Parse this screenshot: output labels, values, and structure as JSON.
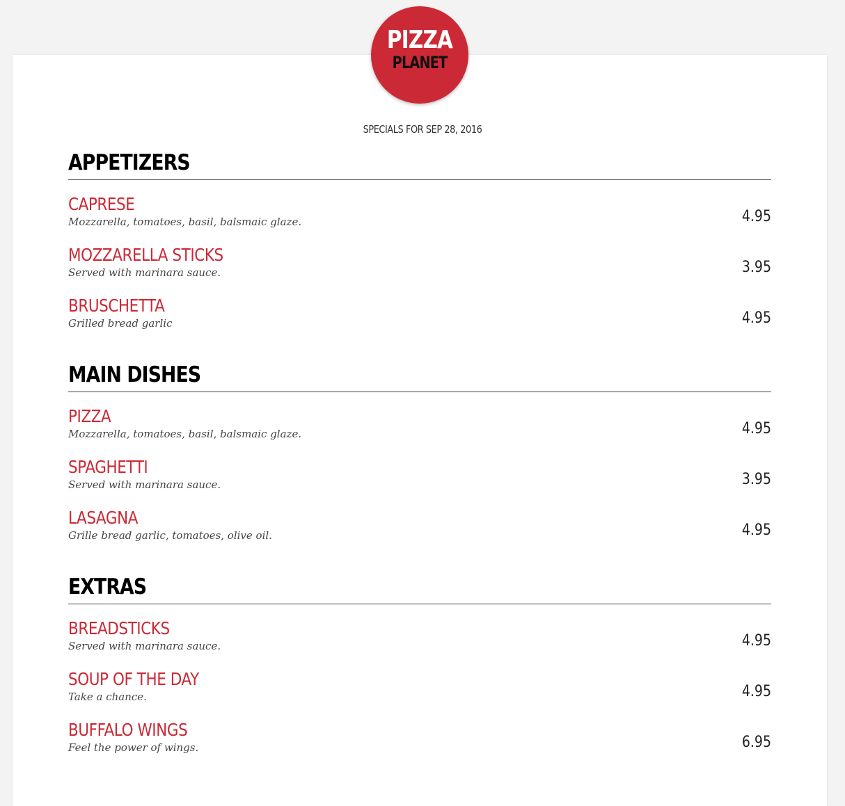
{
  "logo": {
    "top_text": "PIZZA",
    "bottom_text": "PLANET",
    "background_color": "#cc2936"
  },
  "specials_text": "SPECIALS FOR SEP 28, 2016",
  "sections": [
    {
      "title": "APPETIZERS",
      "items": [
        {
          "name": "CAPRESE",
          "description": "Mozzarella, tomatoes, basil, balsmaic glaze.",
          "price": "4.95"
        },
        {
          "name": "MOZZARELLA STICKS",
          "description": "Served with marinara sauce.",
          "price": "3.95"
        },
        {
          "name": "BRUSCHETTA",
          "description": "Grilled bread garlic",
          "price": "4.95"
        }
      ]
    },
    {
      "title": "MAIN DISHES",
      "items": [
        {
          "name": "PIZZA",
          "description": "Mozzarella, tomatoes, basil, balsmaic glaze.",
          "price": "4.95"
        },
        {
          "name": "SPAGHETTI",
          "description": "Served with marinara sauce.",
          "price": "3.95"
        },
        {
          "name": "LASAGNA",
          "description": "Grille bread garlic, tomatoes, olive oil.",
          "price": "4.95"
        }
      ]
    },
    {
      "title": "EXTRAS",
      "items": [
        {
          "name": "BREADSTICKS",
          "description": "Served with marinara sauce.",
          "price": "4.95"
        },
        {
          "name": "SOUP OF THE DAY",
          "description": "Take a chance.",
          "price": "4.95"
        },
        {
          "name": "BUFFALO WINGS",
          "description": "Feel the power of wings.",
          "price": "6.95"
        }
      ]
    }
  ],
  "colors": {
    "accent": "#cc2936",
    "heading": "#000000",
    "page_background": "#f3f3f3",
    "paper": "#ffffff"
  }
}
